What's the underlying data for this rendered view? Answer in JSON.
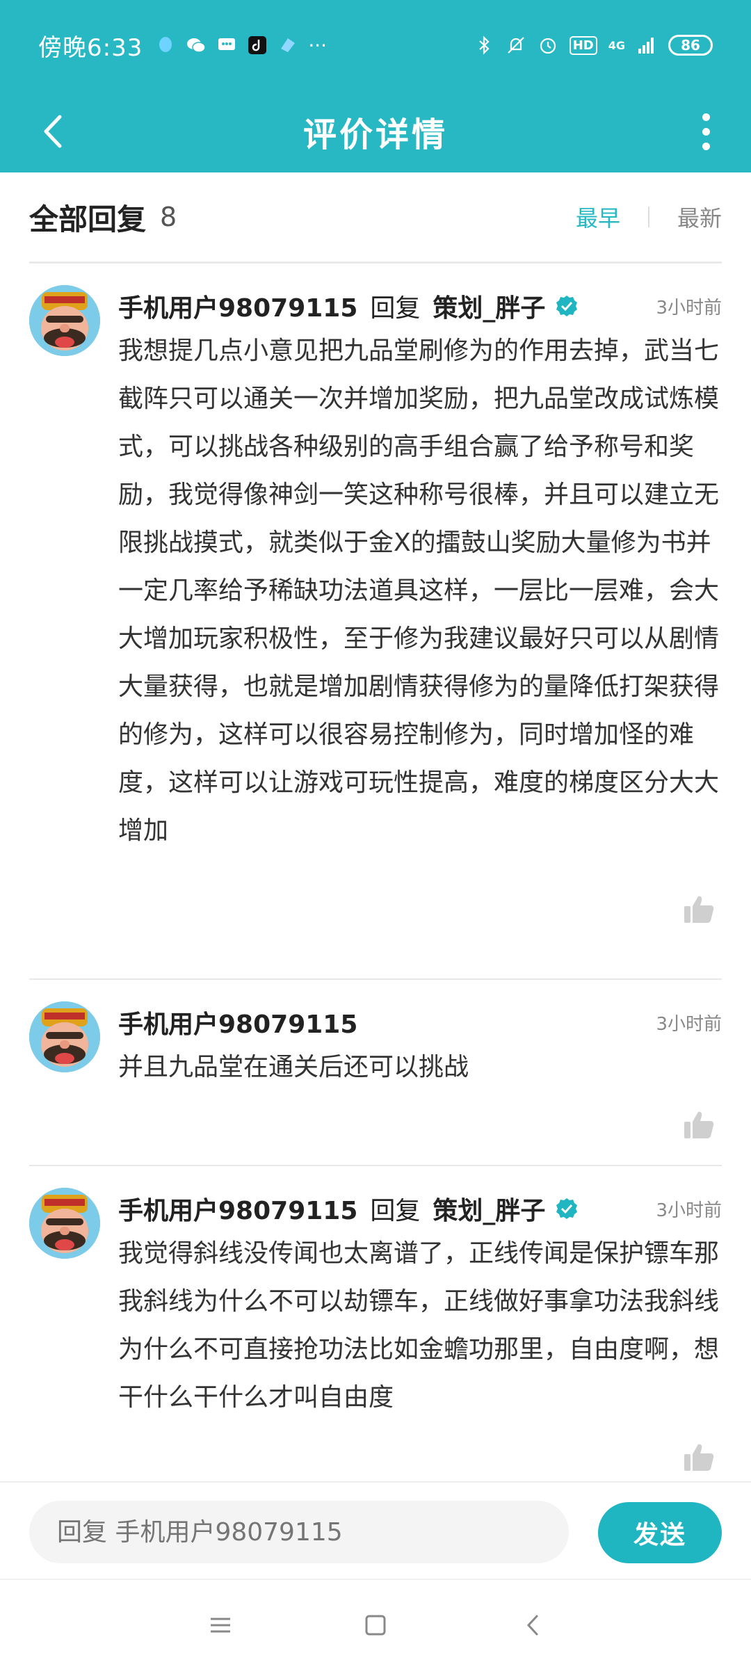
{
  "status_bar": {
    "time": "傍晚6:33",
    "network": "4G",
    "hd": "HD",
    "battery": "86"
  },
  "header": {
    "title": "评价详情"
  },
  "replies_header": {
    "title": "全部回复",
    "count": "8",
    "sort_earliest": "最早",
    "sort_latest": "最新"
  },
  "comments": [
    {
      "user": "手机用户98079115",
      "reply_word": "回复",
      "reply_to": "策划_胖子",
      "time": "3小时前",
      "text": "我想提几点小意见把九品堂刷修为的作用去掉，武当七截阵只可以通关一次并增加奖励，把九品堂改成试炼模式，可以挑战各种级别的高手组合赢了给予称号和奖励，我觉得像神剑一笑这种称号很棒，并且可以建立无限挑战摸式，就类似于金X的擂鼓山奖励大量修为书并一定几率给予稀缺功法道具这样，一层比一层难，会大大增加玩家积极性，至于修为我建议最好只可以从剧情大量获得，也就是增加剧情获得修为的量降低打架获得的修为，这样可以很容易控制修为，同时增加怪的难度，这样可以让游戏可玩性提高，难度的梯度区分大大增加"
    },
    {
      "user": "手机用户98079115",
      "time": "3小时前",
      "text": "并且九品堂在通关后还可以挑战"
    },
    {
      "user": "手机用户98079115",
      "reply_word": "回复",
      "reply_to": "策划_胖子",
      "time": "3小时前",
      "text": "我觉得斜线没传闻也太离谱了，正线传闻是保护镖车那我斜线为什么不可以劫镖车，正线做好事拿功法我斜线为什么不可直接抢功法比如金蟾功那里，自由度啊，想干什么干什么才叫自由度"
    }
  ],
  "input_bar": {
    "placeholder": "回复 手机用户98079115",
    "send_label": "发送"
  },
  "colors": {
    "accent": "#27b8c3",
    "verified": "#1fb5c1"
  }
}
